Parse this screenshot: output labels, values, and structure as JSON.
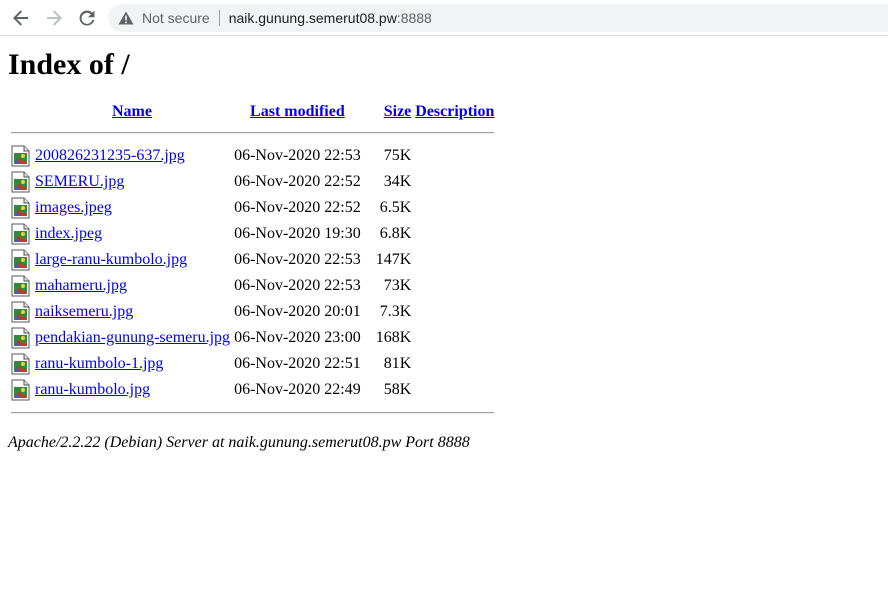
{
  "browser": {
    "security_label": "Not secure",
    "url_host": "naik.gunung.semerut08.pw",
    "url_port": ":8888"
  },
  "page": {
    "title": "Index of /",
    "columns": {
      "name": "Name",
      "last_modified": "Last modified",
      "size": "Size",
      "description": "Description"
    },
    "files": [
      {
        "name": "200826231235-637.jpg",
        "modified": "06-Nov-2020 22:53",
        "size": "75K",
        "description": ""
      },
      {
        "name": "SEMERU.jpg",
        "modified": "06-Nov-2020 22:52",
        "size": "34K",
        "description": ""
      },
      {
        "name": "images.jpeg",
        "modified": "06-Nov-2020 22:52",
        "size": "6.5K",
        "description": ""
      },
      {
        "name": "index.jpeg",
        "modified": "06-Nov-2020 19:30",
        "size": "6.8K",
        "description": ""
      },
      {
        "name": "large-ranu-kumbolo.jpg",
        "modified": "06-Nov-2020 22:53",
        "size": "147K",
        "description": ""
      },
      {
        "name": "mahameru.jpg",
        "modified": "06-Nov-2020 22:53",
        "size": "73K",
        "description": ""
      },
      {
        "name": "naiksemeru.jpg",
        "modified": "06-Nov-2020 20:01",
        "size": "7.3K",
        "description": ""
      },
      {
        "name": "pendakian-gunung-semeru.jpg",
        "modified": "06-Nov-2020 23:00",
        "size": "168K",
        "description": ""
      },
      {
        "name": "ranu-kumbolo-1.jpg",
        "modified": "06-Nov-2020 22:51",
        "size": "81K",
        "description": ""
      },
      {
        "name": "ranu-kumbolo.jpg",
        "modified": "06-Nov-2020 22:49",
        "size": "58K",
        "description": ""
      }
    ],
    "server_signature": "Apache/2.2.22 (Debian) Server at naik.gunung.semerut08.pw Port 8888"
  },
  "icons": {
    "back": "back-arrow-icon",
    "forward": "forward-arrow-icon",
    "reload": "reload-icon",
    "warning": "warning-triangle-icon",
    "file": "image-file-icon"
  },
  "colors": {
    "link": "#0000ee",
    "omnibox_bg": "#f1f3f4"
  }
}
